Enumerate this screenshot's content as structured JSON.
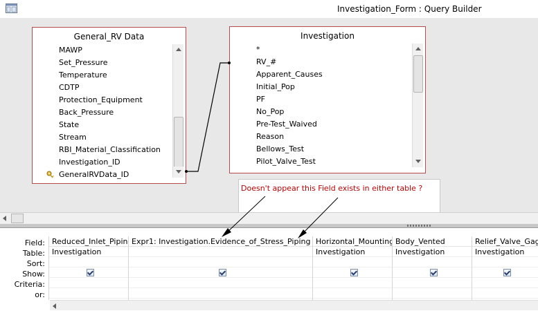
{
  "window": {
    "title": "Investigation_Form : Query Builder",
    "icon": "query-builder-app-icon"
  },
  "tables": [
    {
      "title": "General_RV Data",
      "fields": [
        "MAWP",
        "Set_Pressure",
        "Temperature",
        "CDTP",
        "Protection_Equipment",
        "Back_Pressure",
        "State",
        "Stream",
        "RBI_Material_Classification",
        "Investigation_ID",
        "GeneralRVData_ID"
      ],
      "primary_key_field": "GeneralRVData_ID"
    },
    {
      "title": "Investigation",
      "fields": [
        "*",
        "RV_#",
        "Apparent_Causes",
        "Initial_Pop",
        "PF",
        "No_Pop",
        "Pre-Test_Waived",
        "Reason",
        "Bellows_Test",
        "Pilot_Valve_Test"
      ]
    }
  ],
  "callout": {
    "text": "Doesn't appear this Field exists in either table ?",
    "color": "#c00000"
  },
  "grid": {
    "row_labels": [
      "Field:",
      "Table:",
      "Sort:",
      "Show:",
      "Criteria:",
      "or:"
    ],
    "columns": [
      {
        "field": "Reduced_Inlet_Piping",
        "table": "Investigation",
        "show": true
      },
      {
        "field": "Expr1: Investigation.Evidence_of_Stress_Piping",
        "table": "",
        "show": true
      },
      {
        "field": "Horizontal_Mounting",
        "table": "Investigation",
        "show": true
      },
      {
        "field": "Body_Vented",
        "table": "Investigation",
        "show": true
      },
      {
        "field": "Relief_Valve_Gagg",
        "table": "Investigation",
        "show": true
      }
    ]
  },
  "colors": {
    "table_border": "#b54b4b",
    "diagram_background": "#e8e8e8"
  }
}
